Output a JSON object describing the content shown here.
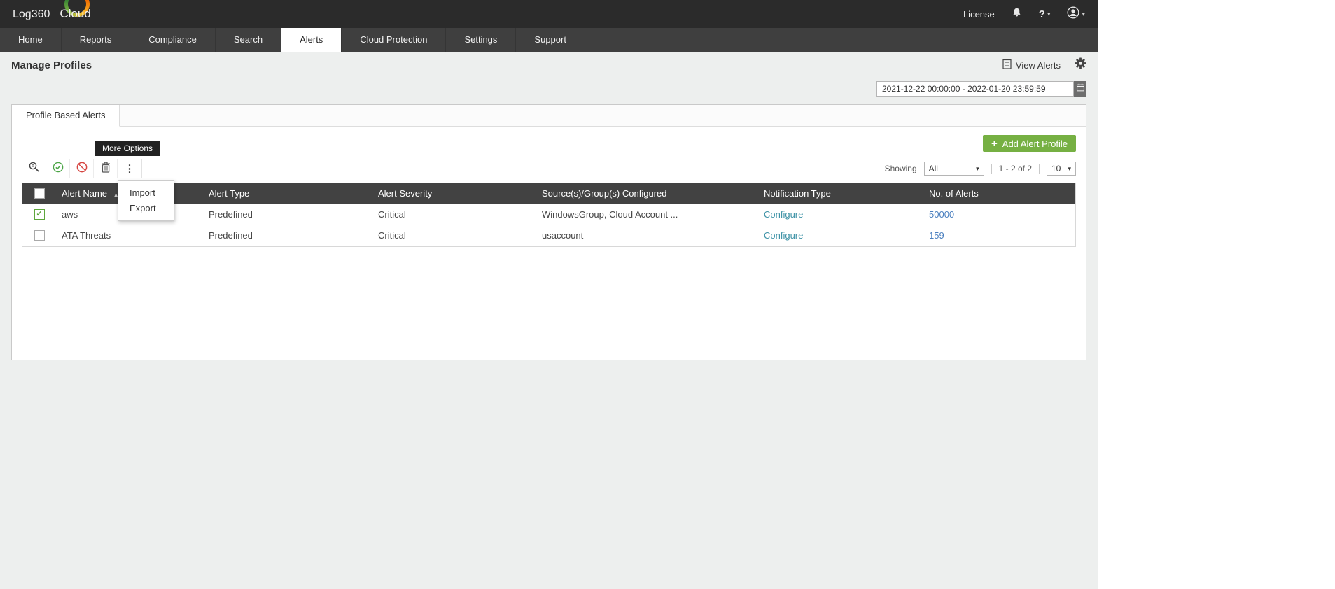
{
  "topbar": {
    "logo_primary": "Log360",
    "logo_secondary": "Cloud",
    "license_label": "License"
  },
  "nav": {
    "items": [
      {
        "label": "Home",
        "active": false
      },
      {
        "label": "Reports",
        "active": false
      },
      {
        "label": "Compliance",
        "active": false
      },
      {
        "label": "Search",
        "active": false
      },
      {
        "label": "Alerts",
        "active": true
      },
      {
        "label": "Cloud Protection",
        "active": false
      },
      {
        "label": "Settings",
        "active": false
      },
      {
        "label": "Support",
        "active": false
      }
    ]
  },
  "page": {
    "title": "Manage Profiles",
    "view_alerts_label": "View Alerts",
    "date_range": "2021-12-22 00:00:00 - 2022-01-20 23:59:59"
  },
  "panel": {
    "tab_label": "Profile Based Alerts",
    "add_alert_label": "Add Alert Profile",
    "tooltip": "More Options",
    "menu": {
      "items": [
        {
          "label": "Import"
        },
        {
          "label": "Export"
        }
      ]
    },
    "paging": {
      "showing_label": "Showing",
      "filter_value": "All",
      "range_text": "1 - 2 of 2",
      "page_size": "10"
    }
  },
  "table": {
    "columns": [
      "Alert Name",
      "Alert Type",
      "Alert Severity",
      "Source(s)/Group(s) Configured",
      "Notification Type",
      "No. of Alerts"
    ],
    "rows": [
      {
        "checked": true,
        "name": "aws",
        "type": "Predefined",
        "severity": "Critical",
        "source": "WindowsGroup, Cloud Account ...",
        "notification": "Configure",
        "alerts": "50000"
      },
      {
        "checked": false,
        "name": "ATA Threats",
        "type": "Predefined",
        "severity": "Critical",
        "source": "usaccount",
        "notification": "Configure",
        "alerts": "159"
      }
    ]
  },
  "icons": {
    "more_options": "⋮",
    "caret_down": "▾",
    "sort_asc": "▲",
    "plus": "+",
    "checkmark": "✓",
    "help": "?"
  },
  "colors": {
    "accent_green": "#76b043",
    "link_teal": "#3f93a7",
    "link_blue": "#4a7fbf",
    "table_header": "#424242"
  }
}
